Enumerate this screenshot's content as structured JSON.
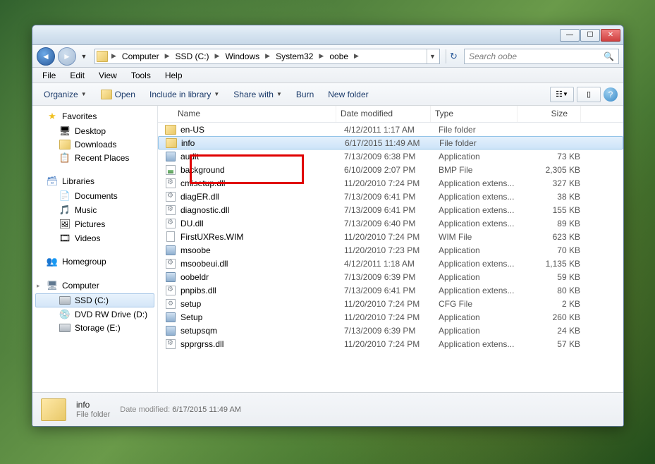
{
  "window": {
    "breadcrumbs": [
      "Computer",
      "SSD (C:)",
      "Windows",
      "System32",
      "oobe"
    ],
    "search_placeholder": "Search oobe"
  },
  "menubar": [
    "File",
    "Edit",
    "View",
    "Tools",
    "Help"
  ],
  "toolbar": {
    "organize": "Organize",
    "open": "Open",
    "include": "Include in library",
    "share": "Share with",
    "burn": "Burn",
    "newfolder": "New folder"
  },
  "navpane": {
    "favorites": {
      "label": "Favorites",
      "items": [
        "Desktop",
        "Downloads",
        "Recent Places"
      ]
    },
    "libraries": {
      "label": "Libraries",
      "items": [
        "Documents",
        "Music",
        "Pictures",
        "Videos"
      ]
    },
    "homegroup": {
      "label": "Homegroup"
    },
    "computer": {
      "label": "Computer",
      "items": [
        "SSD (C:)",
        "DVD RW Drive (D:)",
        "Storage (E:)"
      ]
    }
  },
  "columns": {
    "name": "Name",
    "date": "Date modified",
    "type": "Type",
    "size": "Size"
  },
  "files": [
    {
      "icon": "folder",
      "name": "en-US",
      "date": "4/12/2011 1:17 AM",
      "type": "File folder",
      "size": "",
      "selected": false
    },
    {
      "icon": "folder",
      "name": "info",
      "date": "6/17/2015 11:49 AM",
      "type": "File folder",
      "size": "",
      "selected": true
    },
    {
      "icon": "app",
      "name": "audit",
      "date": "7/13/2009 6:38 PM",
      "type": "Application",
      "size": "73 KB"
    },
    {
      "icon": "img",
      "name": "background",
      "date": "6/10/2009 2:07 PM",
      "type": "BMP File",
      "size": "2,305 KB"
    },
    {
      "icon": "dll",
      "name": "cmisetup.dll",
      "date": "11/20/2010 7:24 PM",
      "type": "Application extens...",
      "size": "327 KB"
    },
    {
      "icon": "dll",
      "name": "diagER.dll",
      "date": "7/13/2009 6:41 PM",
      "type": "Application extens...",
      "size": "38 KB"
    },
    {
      "icon": "dll",
      "name": "diagnostic.dll",
      "date": "7/13/2009 6:41 PM",
      "type": "Application extens...",
      "size": "155 KB"
    },
    {
      "icon": "dll",
      "name": "DU.dll",
      "date": "7/13/2009 6:40 PM",
      "type": "Application extens...",
      "size": "89 KB"
    },
    {
      "icon": "file",
      "name": "FirstUXRes.WIM",
      "date": "11/20/2010 7:24 PM",
      "type": "WIM File",
      "size": "623 KB"
    },
    {
      "icon": "app",
      "name": "msoobe",
      "date": "11/20/2010 7:23 PM",
      "type": "Application",
      "size": "70 KB"
    },
    {
      "icon": "dll",
      "name": "msoobeui.dll",
      "date": "4/12/2011 1:18 AM",
      "type": "Application extens...",
      "size": "1,135 KB"
    },
    {
      "icon": "app",
      "name": "oobeldr",
      "date": "7/13/2009 6:39 PM",
      "type": "Application",
      "size": "59 KB"
    },
    {
      "icon": "dll",
      "name": "pnpibs.dll",
      "date": "7/13/2009 6:41 PM",
      "type": "Application extens...",
      "size": "80 KB"
    },
    {
      "icon": "cfg",
      "name": "setup",
      "date": "11/20/2010 7:24 PM",
      "type": "CFG File",
      "size": "2 KB"
    },
    {
      "icon": "app",
      "name": "Setup",
      "date": "11/20/2010 7:24 PM",
      "type": "Application",
      "size": "260 KB"
    },
    {
      "icon": "app",
      "name": "setupsqm",
      "date": "7/13/2009 6:39 PM",
      "type": "Application",
      "size": "24 KB"
    },
    {
      "icon": "dll",
      "name": "spprgrss.dll",
      "date": "11/20/2010 7:24 PM",
      "type": "Application extens...",
      "size": "57 KB"
    }
  ],
  "statusbar": {
    "name": "info",
    "type": "File folder",
    "modified_label": "Date modified:",
    "modified_value": "6/17/2015 11:49 AM"
  }
}
